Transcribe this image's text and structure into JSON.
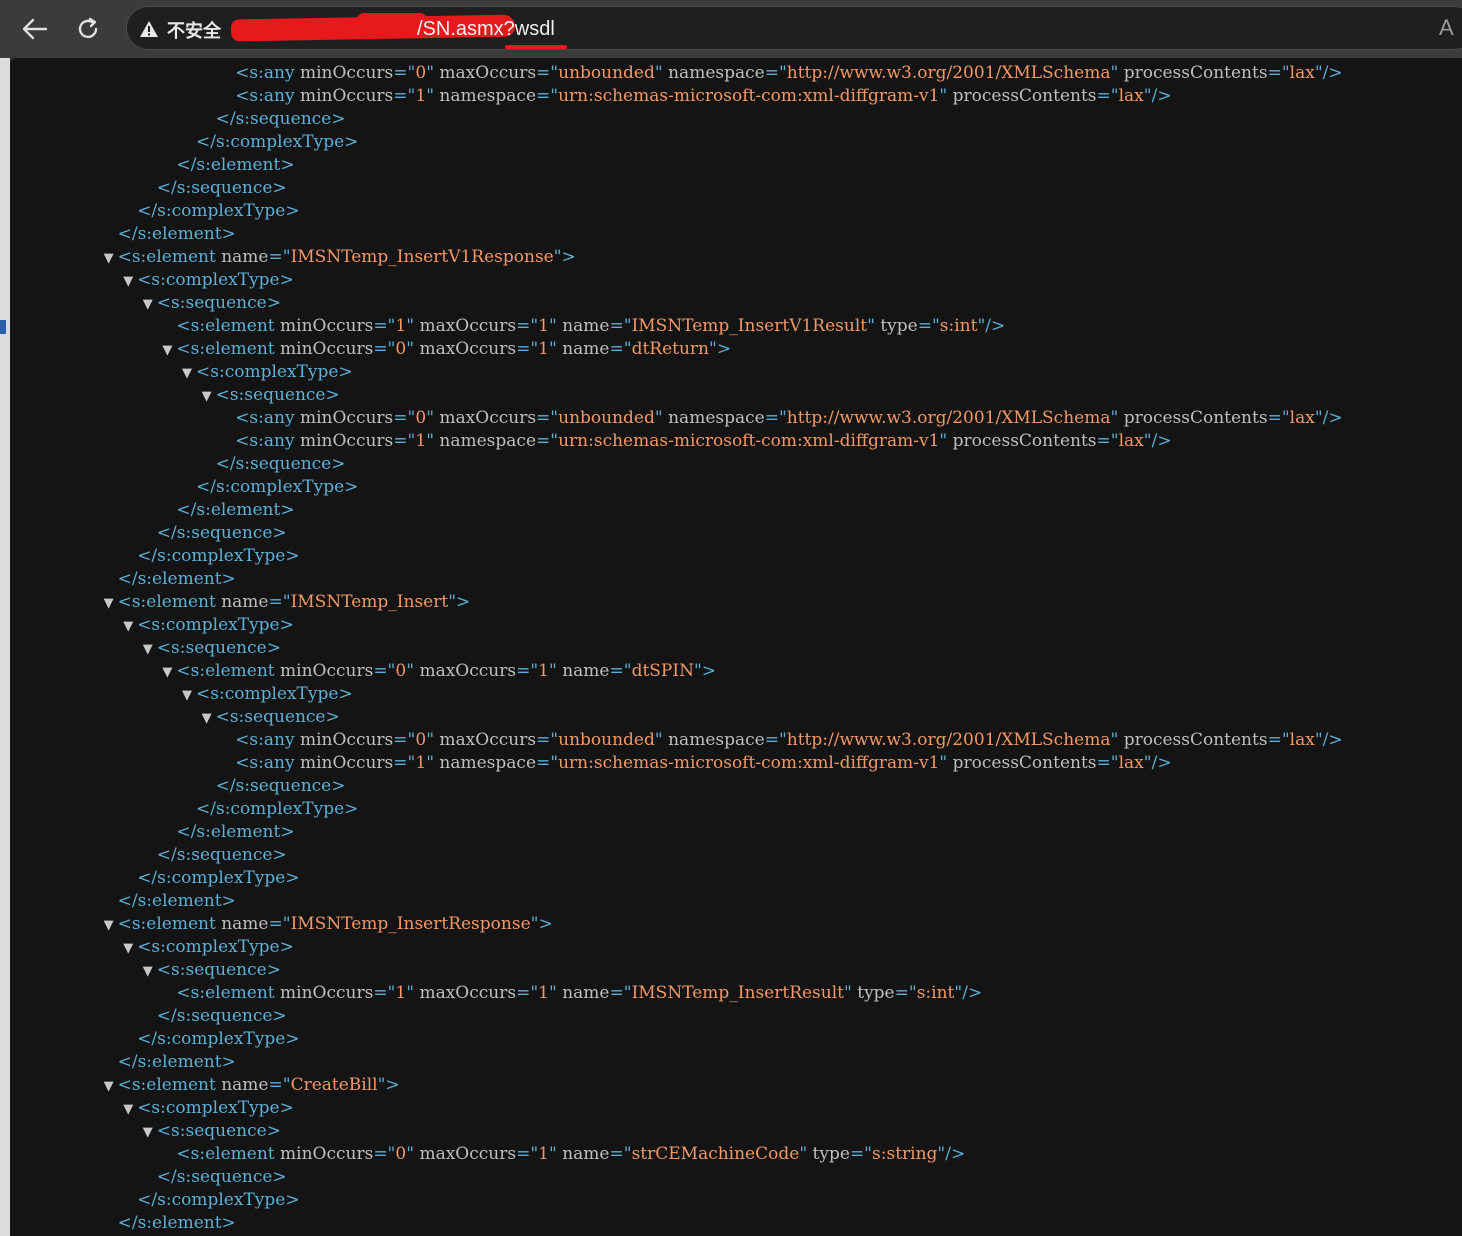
{
  "browser": {
    "insecure_label": "不安全",
    "url": "/SN.asmx?wsdl",
    "read_aloud": "A"
  },
  "xml_lines": [
    {
      "indent": 7,
      "toggle": false,
      "parts": [
        [
          "t",
          "<s:any "
        ],
        [
          "a",
          "minOccurs"
        ],
        [
          "t",
          "=\""
        ],
        [
          "v",
          "0"
        ],
        [
          "t",
          "\" "
        ],
        [
          "a",
          "maxOccurs"
        ],
        [
          "t",
          "=\""
        ],
        [
          "v",
          "unbounded"
        ],
        [
          "t",
          "\" "
        ],
        [
          "a",
          "namespace"
        ],
        [
          "t",
          "=\""
        ],
        [
          "v",
          "http://www.w3.org/2001/XMLSchema"
        ],
        [
          "t",
          "\" "
        ],
        [
          "a",
          "processContents"
        ],
        [
          "t",
          "=\""
        ],
        [
          "v",
          "lax"
        ],
        [
          "t",
          "\"/>"
        ]
      ]
    },
    {
      "indent": 7,
      "toggle": false,
      "parts": [
        [
          "t",
          "<s:any "
        ],
        [
          "a",
          "minOccurs"
        ],
        [
          "t",
          "=\""
        ],
        [
          "v",
          "1"
        ],
        [
          "t",
          "\" "
        ],
        [
          "a",
          "namespace"
        ],
        [
          "t",
          "=\""
        ],
        [
          "v",
          "urn:schemas-microsoft-com:xml-diffgram-v1"
        ],
        [
          "t",
          "\" "
        ],
        [
          "a",
          "processContents"
        ],
        [
          "t",
          "=\""
        ],
        [
          "v",
          "lax"
        ],
        [
          "t",
          "\"/>"
        ]
      ]
    },
    {
      "indent": 6,
      "toggle": false,
      "parts": [
        [
          "t",
          "</s:sequence>"
        ]
      ]
    },
    {
      "indent": 5,
      "toggle": false,
      "parts": [
        [
          "t",
          "</s:complexType>"
        ]
      ]
    },
    {
      "indent": 4,
      "toggle": false,
      "parts": [
        [
          "t",
          "</s:element>"
        ]
      ]
    },
    {
      "indent": 3,
      "toggle": false,
      "parts": [
        [
          "t",
          "</s:sequence>"
        ]
      ]
    },
    {
      "indent": 2,
      "toggle": false,
      "parts": [
        [
          "t",
          "</s:complexType>"
        ]
      ]
    },
    {
      "indent": 1,
      "toggle": false,
      "parts": [
        [
          "t",
          "</s:element>"
        ]
      ]
    },
    {
      "indent": 1,
      "toggle": true,
      "parts": [
        [
          "t",
          "<s:element "
        ],
        [
          "a",
          "name"
        ],
        [
          "t",
          "=\""
        ],
        [
          "v",
          "IMSNTemp_InsertV1Response"
        ],
        [
          "t",
          "\">"
        ]
      ]
    },
    {
      "indent": 2,
      "toggle": true,
      "parts": [
        [
          "t",
          "<s:complexType>"
        ]
      ]
    },
    {
      "indent": 3,
      "toggle": true,
      "parts": [
        [
          "t",
          "<s:sequence>"
        ]
      ]
    },
    {
      "indent": 4,
      "toggle": false,
      "parts": [
        [
          "t",
          "<s:element "
        ],
        [
          "a",
          "minOccurs"
        ],
        [
          "t",
          "=\""
        ],
        [
          "v",
          "1"
        ],
        [
          "t",
          "\" "
        ],
        [
          "a",
          "maxOccurs"
        ],
        [
          "t",
          "=\""
        ],
        [
          "v",
          "1"
        ],
        [
          "t",
          "\" "
        ],
        [
          "a",
          "name"
        ],
        [
          "t",
          "=\""
        ],
        [
          "v",
          "IMSNTemp_InsertV1Result"
        ],
        [
          "t",
          "\" "
        ],
        [
          "a",
          "type"
        ],
        [
          "t",
          "=\""
        ],
        [
          "v",
          "s:int"
        ],
        [
          "t",
          "\"/>"
        ]
      ]
    },
    {
      "indent": 4,
      "toggle": true,
      "parts": [
        [
          "t",
          "<s:element "
        ],
        [
          "a",
          "minOccurs"
        ],
        [
          "t",
          "=\""
        ],
        [
          "v",
          "0"
        ],
        [
          "t",
          "\" "
        ],
        [
          "a",
          "maxOccurs"
        ],
        [
          "t",
          "=\""
        ],
        [
          "v",
          "1"
        ],
        [
          "t",
          "\" "
        ],
        [
          "a",
          "name"
        ],
        [
          "t",
          "=\""
        ],
        [
          "v",
          "dtReturn"
        ],
        [
          "t",
          "\">"
        ]
      ]
    },
    {
      "indent": 5,
      "toggle": true,
      "parts": [
        [
          "t",
          "<s:complexType>"
        ]
      ]
    },
    {
      "indent": 6,
      "toggle": true,
      "parts": [
        [
          "t",
          "<s:sequence>"
        ]
      ]
    },
    {
      "indent": 7,
      "toggle": false,
      "parts": [
        [
          "t",
          "<s:any "
        ],
        [
          "a",
          "minOccurs"
        ],
        [
          "t",
          "=\""
        ],
        [
          "v",
          "0"
        ],
        [
          "t",
          "\" "
        ],
        [
          "a",
          "maxOccurs"
        ],
        [
          "t",
          "=\""
        ],
        [
          "v",
          "unbounded"
        ],
        [
          "t",
          "\" "
        ],
        [
          "a",
          "namespace"
        ],
        [
          "t",
          "=\""
        ],
        [
          "v",
          "http://www.w3.org/2001/XMLSchema"
        ],
        [
          "t",
          "\" "
        ],
        [
          "a",
          "processContents"
        ],
        [
          "t",
          "=\""
        ],
        [
          "v",
          "lax"
        ],
        [
          "t",
          "\"/>"
        ]
      ]
    },
    {
      "indent": 7,
      "toggle": false,
      "parts": [
        [
          "t",
          "<s:any "
        ],
        [
          "a",
          "minOccurs"
        ],
        [
          "t",
          "=\""
        ],
        [
          "v",
          "1"
        ],
        [
          "t",
          "\" "
        ],
        [
          "a",
          "namespace"
        ],
        [
          "t",
          "=\""
        ],
        [
          "v",
          "urn:schemas-microsoft-com:xml-diffgram-v1"
        ],
        [
          "t",
          "\" "
        ],
        [
          "a",
          "processContents"
        ],
        [
          "t",
          "=\""
        ],
        [
          "v",
          "lax"
        ],
        [
          "t",
          "\"/>"
        ]
      ]
    },
    {
      "indent": 6,
      "toggle": false,
      "parts": [
        [
          "t",
          "</s:sequence>"
        ]
      ]
    },
    {
      "indent": 5,
      "toggle": false,
      "parts": [
        [
          "t",
          "</s:complexType>"
        ]
      ]
    },
    {
      "indent": 4,
      "toggle": false,
      "parts": [
        [
          "t",
          "</s:element>"
        ]
      ]
    },
    {
      "indent": 3,
      "toggle": false,
      "parts": [
        [
          "t",
          "</s:sequence>"
        ]
      ]
    },
    {
      "indent": 2,
      "toggle": false,
      "parts": [
        [
          "t",
          "</s:complexType>"
        ]
      ]
    },
    {
      "indent": 1,
      "toggle": false,
      "parts": [
        [
          "t",
          "</s:element>"
        ]
      ]
    },
    {
      "indent": 1,
      "toggle": true,
      "parts": [
        [
          "t",
          "<s:element "
        ],
        [
          "a",
          "name"
        ],
        [
          "t",
          "=\""
        ],
        [
          "v",
          "IMSNTemp_Insert"
        ],
        [
          "t",
          "\">"
        ]
      ]
    },
    {
      "indent": 2,
      "toggle": true,
      "parts": [
        [
          "t",
          "<s:complexType>"
        ]
      ]
    },
    {
      "indent": 3,
      "toggle": true,
      "parts": [
        [
          "t",
          "<s:sequence>"
        ]
      ]
    },
    {
      "indent": 4,
      "toggle": true,
      "parts": [
        [
          "t",
          "<s:element "
        ],
        [
          "a",
          "minOccurs"
        ],
        [
          "t",
          "=\""
        ],
        [
          "v",
          "0"
        ],
        [
          "t",
          "\" "
        ],
        [
          "a",
          "maxOccurs"
        ],
        [
          "t",
          "=\""
        ],
        [
          "v",
          "1"
        ],
        [
          "t",
          "\" "
        ],
        [
          "a",
          "name"
        ],
        [
          "t",
          "=\""
        ],
        [
          "v",
          "dtSPIN"
        ],
        [
          "t",
          "\">"
        ]
      ]
    },
    {
      "indent": 5,
      "toggle": true,
      "parts": [
        [
          "t",
          "<s:complexType>"
        ]
      ]
    },
    {
      "indent": 6,
      "toggle": true,
      "parts": [
        [
          "t",
          "<s:sequence>"
        ]
      ]
    },
    {
      "indent": 7,
      "toggle": false,
      "parts": [
        [
          "t",
          "<s:any "
        ],
        [
          "a",
          "minOccurs"
        ],
        [
          "t",
          "=\""
        ],
        [
          "v",
          "0"
        ],
        [
          "t",
          "\" "
        ],
        [
          "a",
          "maxOccurs"
        ],
        [
          "t",
          "=\""
        ],
        [
          "v",
          "unbounded"
        ],
        [
          "t",
          "\" "
        ],
        [
          "a",
          "namespace"
        ],
        [
          "t",
          "=\""
        ],
        [
          "v",
          "http://www.w3.org/2001/XMLSchema"
        ],
        [
          "t",
          "\" "
        ],
        [
          "a",
          "processContents"
        ],
        [
          "t",
          "=\""
        ],
        [
          "v",
          "lax"
        ],
        [
          "t",
          "\"/>"
        ]
      ]
    },
    {
      "indent": 7,
      "toggle": false,
      "parts": [
        [
          "t",
          "<s:any "
        ],
        [
          "a",
          "minOccurs"
        ],
        [
          "t",
          "=\""
        ],
        [
          "v",
          "1"
        ],
        [
          "t",
          "\" "
        ],
        [
          "a",
          "namespace"
        ],
        [
          "t",
          "=\""
        ],
        [
          "v",
          "urn:schemas-microsoft-com:xml-diffgram-v1"
        ],
        [
          "t",
          "\" "
        ],
        [
          "a",
          "processContents"
        ],
        [
          "t",
          "=\""
        ],
        [
          "v",
          "lax"
        ],
        [
          "t",
          "\"/>"
        ]
      ]
    },
    {
      "indent": 6,
      "toggle": false,
      "parts": [
        [
          "t",
          "</s:sequence>"
        ]
      ]
    },
    {
      "indent": 5,
      "toggle": false,
      "parts": [
        [
          "t",
          "</s:complexType>"
        ]
      ]
    },
    {
      "indent": 4,
      "toggle": false,
      "parts": [
        [
          "t",
          "</s:element>"
        ]
      ]
    },
    {
      "indent": 3,
      "toggle": false,
      "parts": [
        [
          "t",
          "</s:sequence>"
        ]
      ]
    },
    {
      "indent": 2,
      "toggle": false,
      "parts": [
        [
          "t",
          "</s:complexType>"
        ]
      ]
    },
    {
      "indent": 1,
      "toggle": false,
      "parts": [
        [
          "t",
          "</s:element>"
        ]
      ]
    },
    {
      "indent": 1,
      "toggle": true,
      "parts": [
        [
          "t",
          "<s:element "
        ],
        [
          "a",
          "name"
        ],
        [
          "t",
          "=\""
        ],
        [
          "v",
          "IMSNTemp_InsertResponse"
        ],
        [
          "t",
          "\">"
        ]
      ]
    },
    {
      "indent": 2,
      "toggle": true,
      "parts": [
        [
          "t",
          "<s:complexType>"
        ]
      ]
    },
    {
      "indent": 3,
      "toggle": true,
      "parts": [
        [
          "t",
          "<s:sequence>"
        ]
      ]
    },
    {
      "indent": 4,
      "toggle": false,
      "parts": [
        [
          "t",
          "<s:element "
        ],
        [
          "a",
          "minOccurs"
        ],
        [
          "t",
          "=\""
        ],
        [
          "v",
          "1"
        ],
        [
          "t",
          "\" "
        ],
        [
          "a",
          "maxOccurs"
        ],
        [
          "t",
          "=\""
        ],
        [
          "v",
          "1"
        ],
        [
          "t",
          "\" "
        ],
        [
          "a",
          "name"
        ],
        [
          "t",
          "=\""
        ],
        [
          "v",
          "IMSNTemp_InsertResult"
        ],
        [
          "t",
          "\" "
        ],
        [
          "a",
          "type"
        ],
        [
          "t",
          "=\""
        ],
        [
          "v",
          "s:int"
        ],
        [
          "t",
          "\"/>"
        ]
      ]
    },
    {
      "indent": 3,
      "toggle": false,
      "parts": [
        [
          "t",
          "</s:sequence>"
        ]
      ]
    },
    {
      "indent": 2,
      "toggle": false,
      "parts": [
        [
          "t",
          "</s:complexType>"
        ]
      ]
    },
    {
      "indent": 1,
      "toggle": false,
      "parts": [
        [
          "t",
          "</s:element>"
        ]
      ]
    },
    {
      "indent": 1,
      "toggle": true,
      "parts": [
        [
          "t",
          "<s:element "
        ],
        [
          "a",
          "name"
        ],
        [
          "t",
          "=\""
        ],
        [
          "v",
          "CreateBill"
        ],
        [
          "t",
          "\">"
        ]
      ]
    },
    {
      "indent": 2,
      "toggle": true,
      "parts": [
        [
          "t",
          "<s:complexType>"
        ]
      ]
    },
    {
      "indent": 3,
      "toggle": true,
      "parts": [
        [
          "t",
          "<s:sequence>"
        ]
      ]
    },
    {
      "indent": 4,
      "toggle": false,
      "parts": [
        [
          "t",
          "<s:element "
        ],
        [
          "a",
          "minOccurs"
        ],
        [
          "t",
          "=\""
        ],
        [
          "v",
          "0"
        ],
        [
          "t",
          "\" "
        ],
        [
          "a",
          "maxOccurs"
        ],
        [
          "t",
          "=\""
        ],
        [
          "v",
          "1"
        ],
        [
          "t",
          "\" "
        ],
        [
          "a",
          "name"
        ],
        [
          "t",
          "=\""
        ],
        [
          "v",
          "strCEMachineCode"
        ],
        [
          "t",
          "\" "
        ],
        [
          "a",
          "type"
        ],
        [
          "t",
          "=\""
        ],
        [
          "v",
          "s:string"
        ],
        [
          "t",
          "\"/>"
        ]
      ]
    },
    {
      "indent": 3,
      "toggle": false,
      "parts": [
        [
          "t",
          "</s:sequence>"
        ]
      ]
    },
    {
      "indent": 2,
      "toggle": false,
      "parts": [
        [
          "t",
          "</s:complexType>"
        ]
      ]
    },
    {
      "indent": 1,
      "toggle": false,
      "parts": [
        [
          "t",
          "</s:element>"
        ]
      ]
    }
  ]
}
